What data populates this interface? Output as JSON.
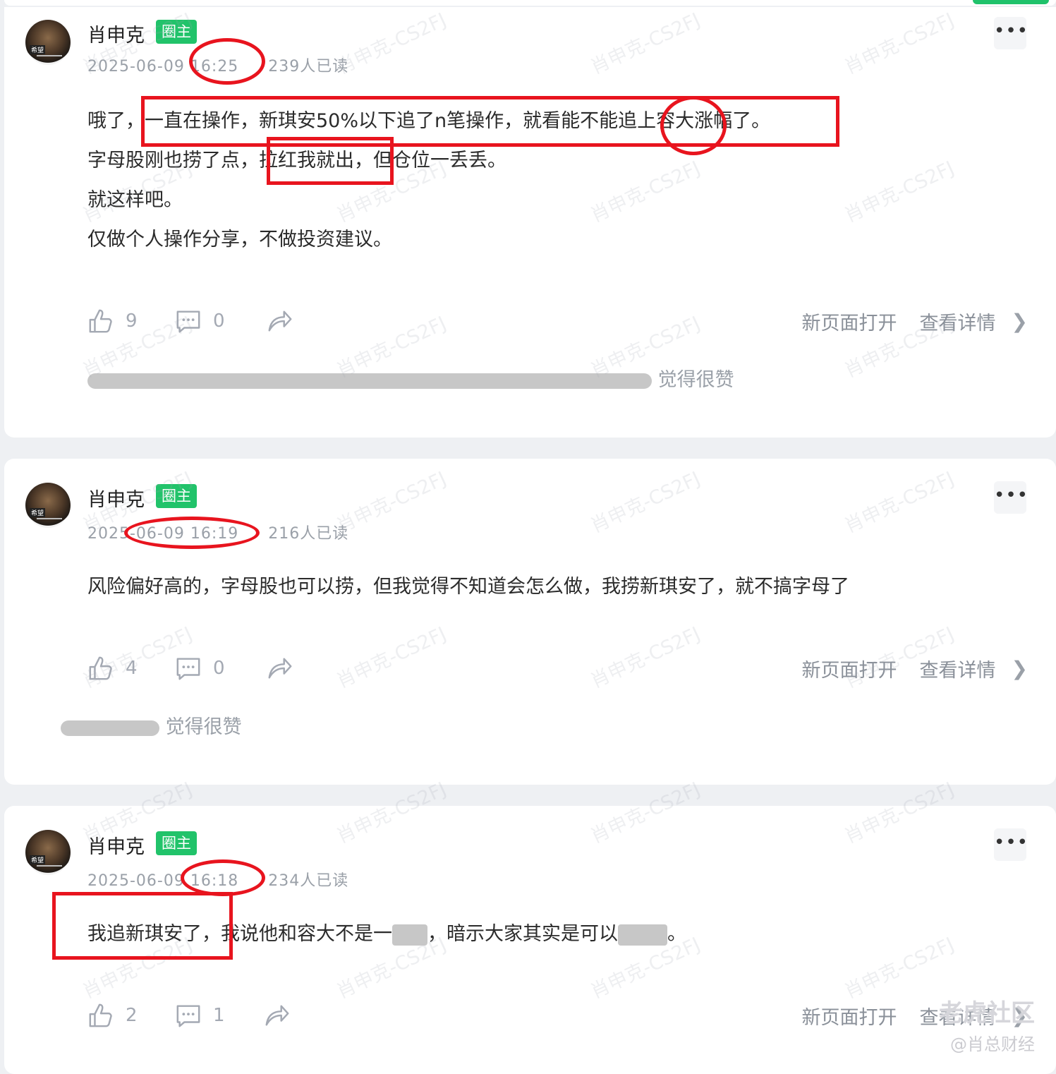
{
  "posts": [
    {
      "author": "肖申克",
      "badge": "圈主",
      "date": "2025-06-09",
      "time": "16:25",
      "reads": "239人已读",
      "lines": [
        "哦了，一直在操作，新琪安50%以下追了n笔操作，就看能不能追上容大涨幅了。",
        "字母股刚也捞了点，拉红我就出，但仓位一丢丢。",
        "就这样吧。",
        "仅做个人操作分享，不做投资建议。"
      ],
      "likes": "9",
      "comments": "0",
      "open_new": "新页面打开",
      "view_detail": "查看详情",
      "likers_suffix": "觉得很赞"
    },
    {
      "author": "肖申克",
      "badge": "圈主",
      "date": "2025-06-09",
      "time": "16:19",
      "reads": "216人已读",
      "lines": [
        "风险偏好高的，字母股也可以捞，但我觉得不知道会怎么做，我捞新琪安了，就不搞字母了"
      ],
      "likes": "4",
      "comments": "0",
      "open_new": "新页面打开",
      "view_detail": "查看详情",
      "likers_suffix": "觉得很赞"
    },
    {
      "author": "肖申克",
      "badge": "圈主",
      "date": "2025-06-09",
      "time": "16:18",
      "reads": "234人已读",
      "lines": [
        "我追新琪安了，我说他和容大不是一",
        "，暗示大家其实是可以",
        "。"
      ],
      "likes": "2",
      "comments": "1",
      "open_new": "新页面打开",
      "view_detail": "查看详情"
    }
  ],
  "watermark": "肖申克-CS2FJ",
  "corner_logo": "老虎社区",
  "corner_credit": "@肖总财经",
  "colors": {
    "badge": "#21c36a",
    "annotation": "#e8141e",
    "accent_green": "#20c26b"
  },
  "icons": [
    "like-icon",
    "comment-icon",
    "share-icon",
    "chevron-right-icon",
    "more-icon"
  ]
}
